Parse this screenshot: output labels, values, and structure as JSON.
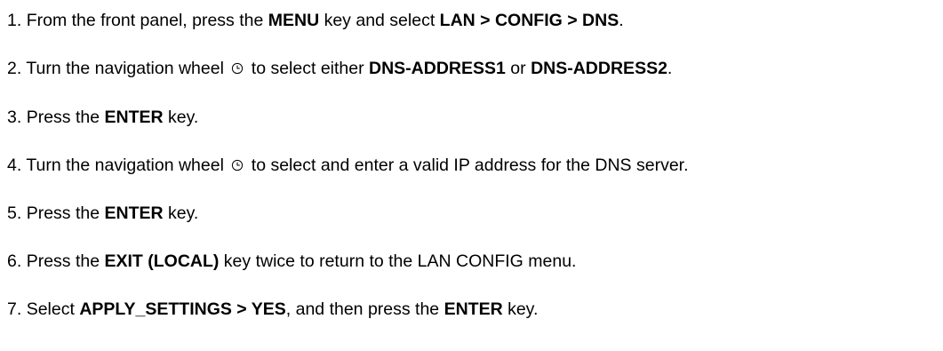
{
  "steps": [
    {
      "number": "1.",
      "t1": "From the front panel, press the ",
      "b1": "MENU",
      "t2": " key and select ",
      "b2": "LAN > CONFIG > DNS",
      "t3": "."
    },
    {
      "number": "2.",
      "t1": "Turn the navigation wheel ",
      "icon": "navigation-wheel-icon",
      "t2": " to select either ",
      "b1": "DNS-ADDRESS1",
      "t3": " or ",
      "b2": "DNS-ADDRESS2",
      "t4": "."
    },
    {
      "number": "3.",
      "t1": "Press the ",
      "b1": "ENTER",
      "t2": " key."
    },
    {
      "number": "4.",
      "t1": "Turn the navigation wheel ",
      "icon": "navigation-wheel-icon",
      "t2": " to select and enter a valid IP address for the DNS server."
    },
    {
      "number": "5.",
      "t1": "Press the ",
      "b1": "ENTER",
      "t2": " key."
    },
    {
      "number": "6.",
      "t1": "Press the ",
      "b1": "EXIT (LOCAL)",
      "t2": " key twice to return to the LAN CONFIG menu."
    },
    {
      "number": "7.",
      "t1": "Select ",
      "b1": "APPLY_SETTINGS > YES",
      "t2": ", and then press the ",
      "b2": "ENTER",
      "t3": " key."
    }
  ]
}
